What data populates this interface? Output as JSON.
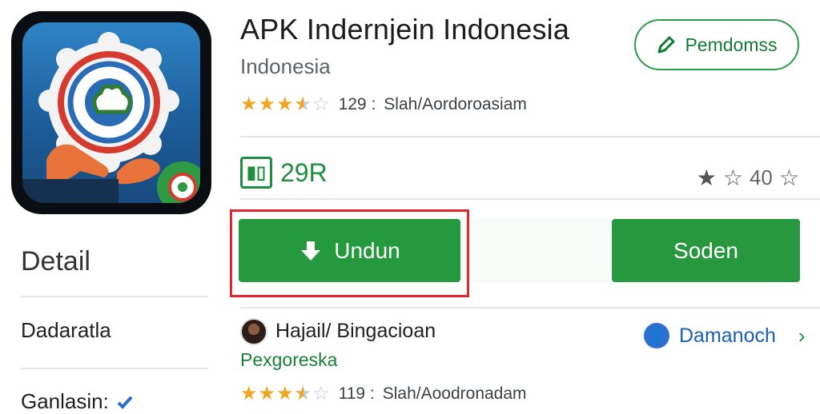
{
  "app": {
    "title": "APK Indernjein Indonesia",
    "subtitle": "Indonesia",
    "rating_stars": 3.5,
    "rating_count": "129 :",
    "rating_category": "Slah/Aordoroasiam"
  },
  "recommend": {
    "label": "Pemdomss",
    "icon": "pencil-icon"
  },
  "size": {
    "value": "29R",
    "icon": "size-icon"
  },
  "right_rating": {
    "value": "40"
  },
  "buttons": {
    "download_label": "Undun",
    "secondary_label": "Soden"
  },
  "detail": {
    "heading": "Detail",
    "row1": "Dadaratla",
    "row2": "Ganlasin:"
  },
  "developer": {
    "name": "Hajail/ Bingacioan",
    "subtitle": "Pexgoreska",
    "link_label": "Damanoch",
    "rating_stars": 3.5,
    "rating_count": "119 :",
    "rating_category": "Slah/Aoodronadam"
  },
  "colors": {
    "accent_green": "#25993e",
    "highlight_red": "#e0262f",
    "star": "#f2a521",
    "link_blue": "#1a5fb4"
  }
}
